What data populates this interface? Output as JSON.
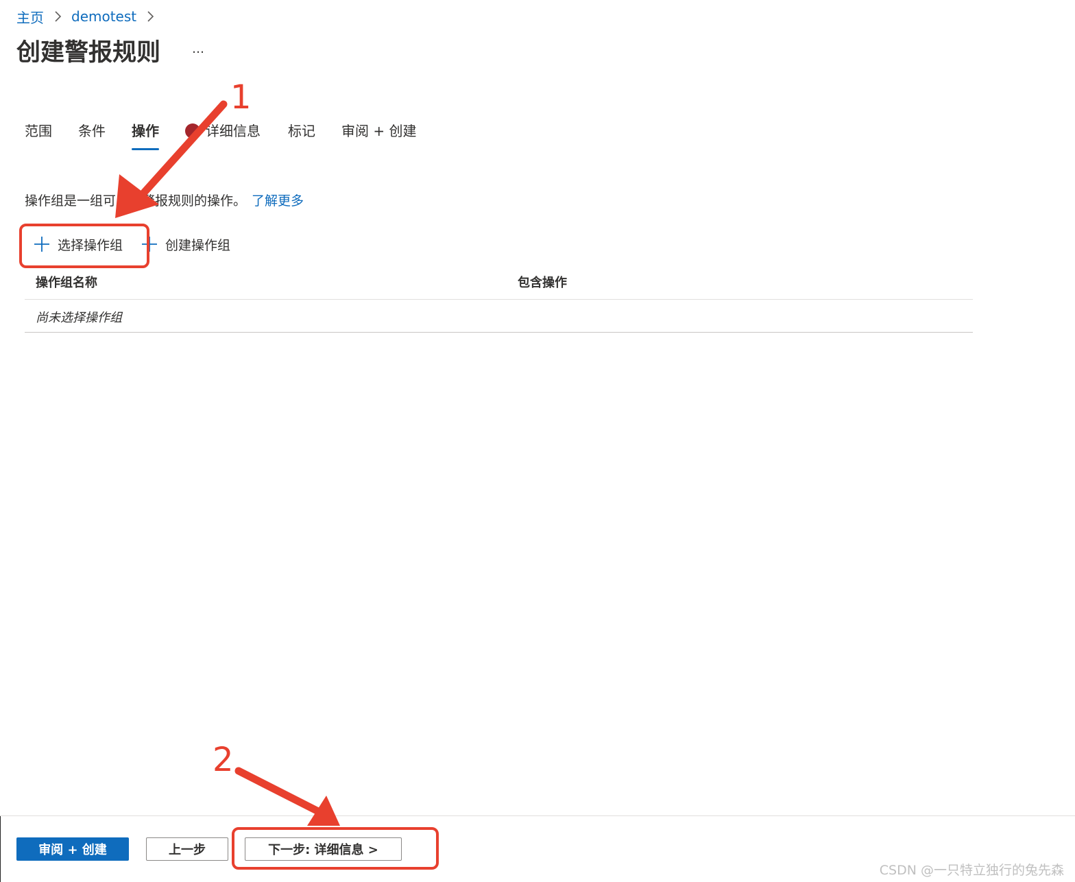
{
  "breadcrumb": {
    "items": [
      "主页",
      "demotest"
    ]
  },
  "header": {
    "title": "创建警报规则",
    "more": "…"
  },
  "tabs": [
    {
      "label": "范围"
    },
    {
      "label": "条件"
    },
    {
      "label": "操作",
      "active": true
    },
    {
      "label": "详细信息",
      "has_error": true
    },
    {
      "label": "标记"
    },
    {
      "label": "审阅 + 创建"
    }
  ],
  "main": {
    "description": "操作组是一组可用于警报规则的操作。",
    "learn_more": "了解更多",
    "select_action_group": "选择操作组",
    "create_action_group": "创建操作组",
    "table": {
      "columns": [
        "操作组名称",
        "包含操作"
      ],
      "empty_text": "尚未选择操作组"
    }
  },
  "footer": {
    "review_create": "审阅 + 创建",
    "previous": "上一步",
    "next": "下一步: 详细信息 >"
  },
  "annotations": {
    "label_1": "1",
    "label_2": "2"
  },
  "watermark": "CSDN @一只特立独行的兔先森",
  "colors": {
    "accent": "#0f6cbd",
    "annotation": "#e8402e",
    "error": "#a4262c"
  }
}
